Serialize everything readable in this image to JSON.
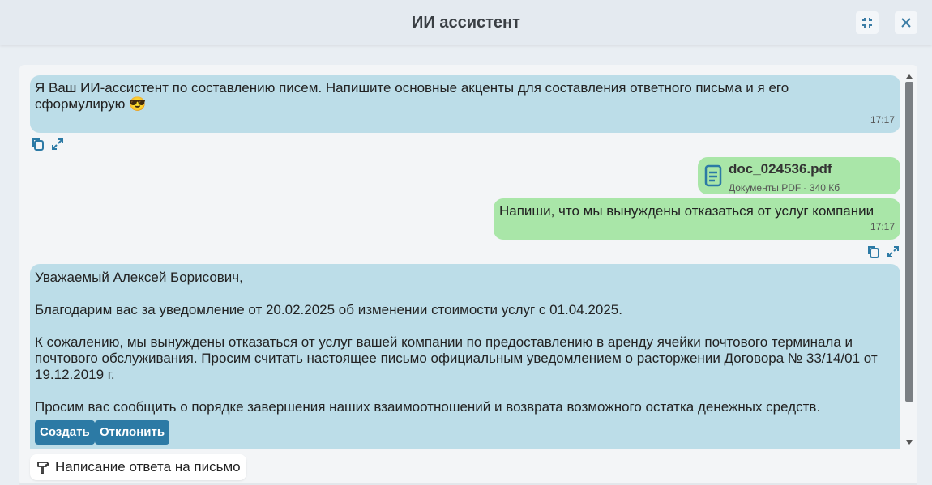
{
  "header": {
    "title": "ИИ ассистент",
    "minimize_icon": "collapse-icon",
    "close_icon": "close-icon"
  },
  "messages": {
    "bot_greeting": {
      "text": "Я Ваш ИИ-ассистент по составлению писем. Напишите основные акценты для составления ответного письма и я его сформулирую 😎",
      "time": "17:17"
    },
    "attachment": {
      "name": "doc_024536.pdf",
      "meta": "Документы PDF - 340 Кб",
      "icon": "document-icon"
    },
    "user_request": {
      "text": "Напиши, что мы вынуждены отказаться от услуг компании",
      "time": "17:17"
    },
    "bot_reply": {
      "p1": "Уважаемый Алексей Борисович,",
      "p2": "Благодарим вас за уведомление от 20.02.2025 об изменении стоимости услуг с 01.04.2025.",
      "p3": "К сожалению, мы вынуждены отказаться от услуг вашей компании по предоставлению в аренду ячейки почтового терминала и почтового обслуживания. Просим считать настоящее письмо официальным уведомлением о расторжении Договора № 33/14/01 от 19.12.2019 г.",
      "p4": "Просим вас сообщить о порядке завершения наших взаимоотношений и возврата возможного остатка денежных средств.",
      "create_label": "Создать",
      "reject_label": "Отклонить"
    }
  },
  "message_actions": {
    "copy_icon": "copy-icon",
    "expand_icon": "expand-icon"
  },
  "mode_chip": {
    "icon": "hammer-icon",
    "label": "Написание ответа на письмо"
  },
  "colors": {
    "bot_bubble": "#bcdde8",
    "user_bubble": "#a9e6a8",
    "accent_button": "#2c7aa5"
  }
}
